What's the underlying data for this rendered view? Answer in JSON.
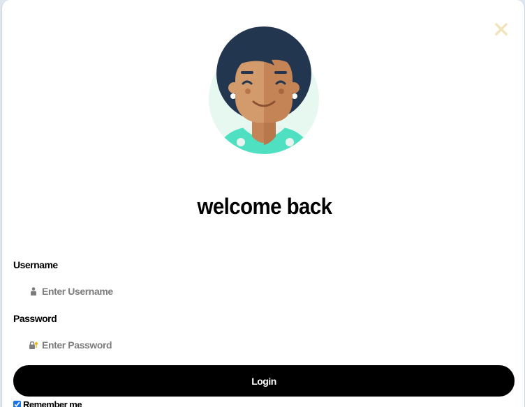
{
  "dialog": {
    "title": "welcome back",
    "close_icon": "close-x-icon",
    "avatar_icon": "woman-avatar-icon"
  },
  "form": {
    "username_label": "Username",
    "username_placeholder": "Enter Username",
    "username_icon": "user-icon",
    "password_label": "Password",
    "password_placeholder": "Enter Password",
    "password_icon": "lock-key-icon",
    "login_label": "Login",
    "remember_label": "Remember me",
    "remember_checked": true
  },
  "colors": {
    "close_icon": "#f3e3bd",
    "button_bg": "#000000",
    "button_text": "#ffffff",
    "avatar_bg": "#e7f8f1",
    "avatar_hair": "#22364f",
    "avatar_skin": "#d39b6c",
    "avatar_shirt": "#4fe0c2"
  }
}
